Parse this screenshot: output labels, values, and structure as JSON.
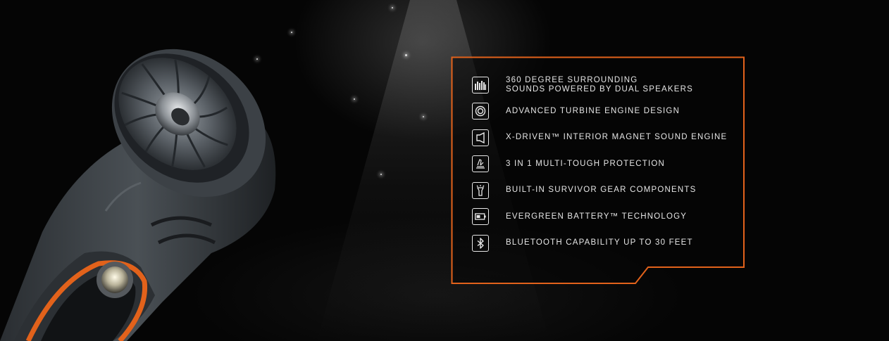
{
  "colors": {
    "accent": "#e2621b",
    "background": "#050505",
    "text": "#e6e6e6"
  },
  "features": [
    {
      "icon": "equalizer-bars-icon",
      "label": "360 DEGREE SURROUNDING\nSOUNDS POWERED BY DUAL SPEAKERS"
    },
    {
      "icon": "turbine-circle-icon",
      "label": "ADVANCED TURBINE ENGINE DESIGN"
    },
    {
      "icon": "speaker-cone-icon",
      "label": "X-DRIVEN™ INTERIOR MAGNET SOUND ENGINE"
    },
    {
      "icon": "tough-protection-icon",
      "label": "3 IN 1 MULTI-TOUGH PROTECTION"
    },
    {
      "icon": "flashlight-icon",
      "label": "BUILT-IN SURVIVOR GEAR COMPONENTS"
    },
    {
      "icon": "battery-icon",
      "label": "EVERGREEN BATTERY™ TECHNOLOGY"
    },
    {
      "icon": "bluetooth-icon",
      "label": "BLUETOOTH CAPABILITY UP TO 30 FEET"
    }
  ]
}
